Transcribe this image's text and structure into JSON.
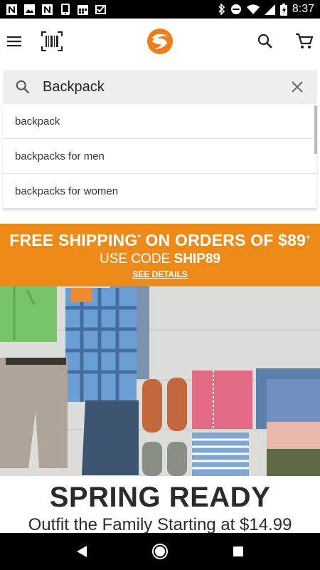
{
  "status_bar": {
    "time": "8:37",
    "left_icons": [
      "n-notification-icon",
      "image-notification-icon",
      "n-notification-icon",
      "phone-notification-icon",
      "calendar-notification-icon",
      "check-notification-icon"
    ],
    "right_icons": [
      "bluetooth-icon",
      "dnd-icon",
      "wifi-icon",
      "signal-icon",
      "battery-icon"
    ]
  },
  "app_bar": {
    "icons": [
      "menu-icon",
      "barcode-icon",
      "logo",
      "search-icon",
      "cart-icon"
    ]
  },
  "search": {
    "value": "Backpack",
    "placeholder": ""
  },
  "suggestions": [
    "backpack",
    "backpacks for men",
    "backpacks for women"
  ],
  "promo": {
    "line1_prefix": "FREE SHIPPING",
    "line1_sup": "*",
    "line1_middle": " ON ORDERS OF $89",
    "line1_sup2": "+",
    "line2_prefix": "USE CODE ",
    "line2_code": "SHIP89",
    "details": "SEE DETAILS"
  },
  "hero": {
    "alt": "clothing-collage-image"
  },
  "spring": {
    "title": "SPRING READY",
    "subtitle": "Outfit the Family Starting at $14.99"
  },
  "colors": {
    "promo_bg": "#ee8a18",
    "logo_orange": "#ee7d1a",
    "search_bg": "#eeeeee"
  }
}
